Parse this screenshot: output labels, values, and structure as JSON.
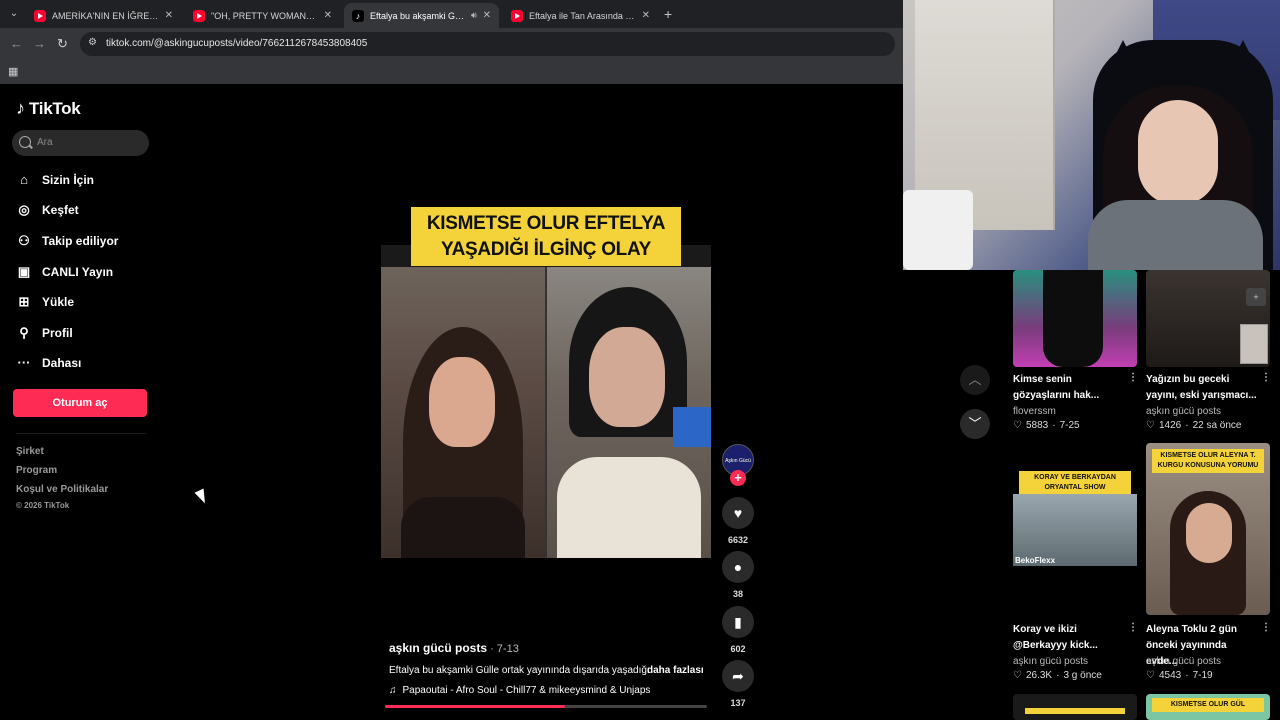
{
  "browser": {
    "tabs": [
      {
        "label": "AMERİKA'NIN EN İĞRENÇ PROJESİ",
        "icon": "youtube-icon",
        "active": false
      },
      {
        "label": "\"OH, PRETTY WOMAN\" - Roy Orbison",
        "icon": "youtube-icon",
        "active": false
      },
      {
        "label": "Eftalya bu akşamki Gülle ortak",
        "icon": "tiktok-icon",
        "active": true
      },
      {
        "label": "Eftalya ile Tan Arasında Büyük Gerilim",
        "icon": "youtube-icon",
        "active": false
      }
    ],
    "url": "tiktok.com/@askingucuposts/video/7662112678453808405"
  },
  "sidebar": {
    "logo": "TikTok",
    "search_placeholder": "Ara",
    "items": [
      {
        "label": "Sizin İçin",
        "icon": "home-icon"
      },
      {
        "label": "Keşfet",
        "icon": "compass-icon"
      },
      {
        "label": "Takip ediliyor",
        "icon": "following-icon"
      },
      {
        "label": "CANLI Yayın",
        "icon": "live-icon"
      },
      {
        "label": "Yükle",
        "icon": "upload-icon"
      },
      {
        "label": "Profil",
        "icon": "profile-icon"
      },
      {
        "label": "Dahası",
        "icon": "more-icon"
      }
    ],
    "login_button": "Oturum aç",
    "footer_links": [
      "Şirket",
      "Program",
      "Koşul ve Politikalar"
    ],
    "copyright": "© 2026 TikTok"
  },
  "video": {
    "caption_lines": [
      "KISMETSE OLUR EFTELYA",
      "YAŞADIĞI İLGİNÇ OLAY"
    ],
    "author": "aşkın gücü posts",
    "date": " · 7-13",
    "description": "Eftalya bu akşamki Gülle ortak yayınında dışarıda yaşadığı",
    "more": "daha fazlası",
    "music": "Papaoutai - Afro Soul - Chill77 & mikeeysmind & Unjaps",
    "progress": 0.56,
    "avatar_text": "Aşkın Gücü Posts",
    "likes": "6632",
    "comments": "38",
    "saves": "602",
    "shares": "137"
  },
  "recommended": [
    {
      "title": "Kimse senin gözyaşlarını hak...",
      "author": "floverssm",
      "likes": "5883",
      "age": "7-25"
    },
    {
      "title": "Yağızın bu geceki yayını, eski yarışmacı...",
      "author": "aşkın gücü posts",
      "likes": "1426",
      "age": "22 sa önce"
    },
    {
      "title": "Koray ve ikizi @Berkayyy kick...",
      "author": "aşkın gücü posts",
      "likes": "26.3K",
      "age": "3 g önce",
      "thumb_label": "KORAY VE BERKAYDAN ORYANTAL SHOW",
      "thumb_credit": "BekoFlexx"
    },
    {
      "title": "Aleyna Toklu 2 gün önceki yayınında evde...",
      "author": "aşkın gücü posts",
      "likes": "4543",
      "age": "7-19",
      "thumb_label": "KISMETSE OLUR ALEYNA T. KURGU KONUSUNA YORUMU"
    },
    {
      "thumb_label": "KISMETSE OLUR GÜL"
    }
  ],
  "colors": {
    "accent": "#fe2c55",
    "caption_bg": "#f4d23a"
  }
}
